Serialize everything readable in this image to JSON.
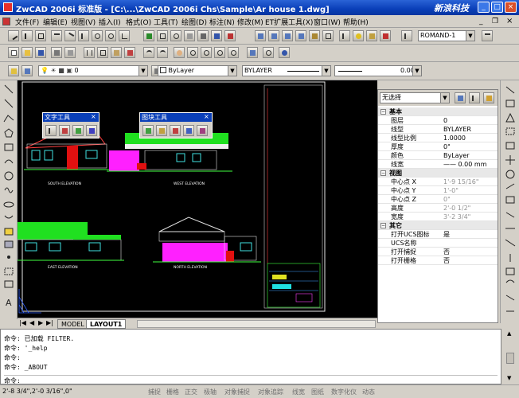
{
  "window": {
    "title": "ZwCAD 2006i 标准版 - [C:\\...\\ZwCAD 2006i Chs\\Sample\\Ar house 1.dwg]",
    "logo": "新浪科技"
  },
  "menu": [
    "文件(F)",
    "编辑(E)",
    "视图(V)",
    "插入(I)",
    "格式(O)",
    "工具(T)",
    "绘图(D)",
    "标注(N)",
    "修改(M)",
    "ET扩展工具(X)",
    "窗口(W)",
    "帮助(H)"
  ],
  "toolbar": {
    "text_style": "ROMAND-1",
    "layer": "0",
    "color": "ByLayer",
    "linetype": "BYLAYER",
    "lineweight": "0.00 mm"
  },
  "floating": {
    "text_tools": "文字工具",
    "block_tools": "图块工具"
  },
  "drawing": {
    "labels": [
      "SOUTH ELEVATION",
      "WEST ELEVATION",
      "EAST ELEVATION",
      "NORTH ELEVATION"
    ]
  },
  "tabs": [
    "MODEL",
    "LAYOUT1"
  ],
  "properties": {
    "selection": "无选择",
    "sections": [
      {
        "title": "基本",
        "rows": [
          {
            "k": "图层",
            "v": "0"
          },
          {
            "k": "线型",
            "v": "BYLAYER"
          },
          {
            "k": "线型比例",
            "v": "1.0000"
          },
          {
            "k": "厚度",
            "v": "0\""
          },
          {
            "k": "颜色",
            "v": "ByLayer"
          },
          {
            "k": "线宽",
            "v": "—— 0.00 mm"
          }
        ]
      },
      {
        "title": "视图",
        "rows": [
          {
            "k": "中心点 X",
            "v": "1'-9 15/16\""
          },
          {
            "k": "中心点 Y",
            "v": "1'-0\""
          },
          {
            "k": "中心点 Z",
            "v": "0\""
          },
          {
            "k": "高度",
            "v": "2'-0 1/2\""
          },
          {
            "k": "宽度",
            "v": "3'-2 3/4\""
          }
        ]
      },
      {
        "title": "其它",
        "rows": [
          {
            "k": "打开UCS图标",
            "v": "是"
          },
          {
            "k": "UCS名称",
            "v": ""
          },
          {
            "k": "打开捕捉",
            "v": "否"
          },
          {
            "k": "打开栅格",
            "v": "否"
          }
        ]
      }
    ]
  },
  "command_lines": [
    "命令:  已加载 FILTER.",
    "命令: '_help",
    "命令:",
    "命令: _ABOUT",
    "命令:"
  ],
  "status": {
    "coords": "2'-8 3/4\",2'-0 3/16\",0\"",
    "buttons": [
      "捕捉",
      "栅格",
      "正交",
      "极轴",
      "对象捕捉",
      "对象追踪",
      "线宽",
      "图纸",
      "数字化仪",
      "动态"
    ]
  }
}
